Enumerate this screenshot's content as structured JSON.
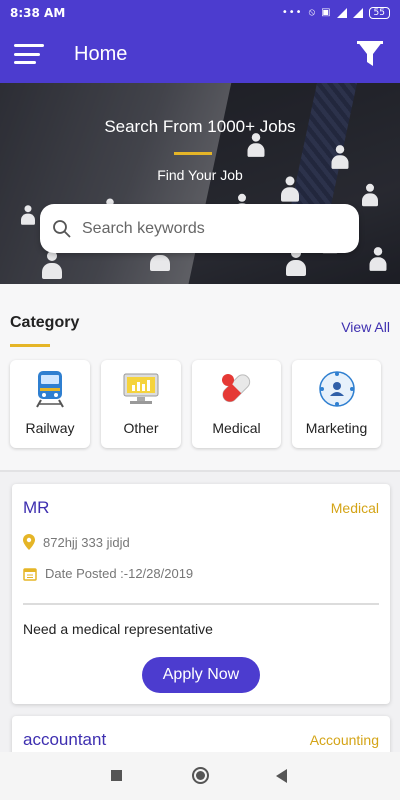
{
  "status_bar": {
    "time": "8:38 AM",
    "battery": "55"
  },
  "appbar": {
    "title": "Home"
  },
  "hero": {
    "title": "Search From 1000+ Jobs",
    "subtitle": "Find Your Job",
    "search_placeholder": "Search keywords"
  },
  "category": {
    "title": "Category",
    "view_all": "View All",
    "items": [
      {
        "label": "Railway",
        "icon": "train-icon"
      },
      {
        "label": "Other",
        "icon": "computer-icon"
      },
      {
        "label": "Medical",
        "icon": "pills-icon"
      },
      {
        "label": "Marketing",
        "icon": "network-people-icon"
      }
    ]
  },
  "jobs": [
    {
      "title": "MR",
      "category": "Medical",
      "location": "872hjj 333 jidjd",
      "date": "Date Posted :-12/28/2019",
      "description": "Need a medical representative",
      "apply_label": "Apply Now"
    },
    {
      "title": "accountant",
      "category": "Accounting"
    }
  ],
  "colors": {
    "primary": "#4c3ccf",
    "accent": "#e5b527",
    "link": "#3e2fb0"
  }
}
